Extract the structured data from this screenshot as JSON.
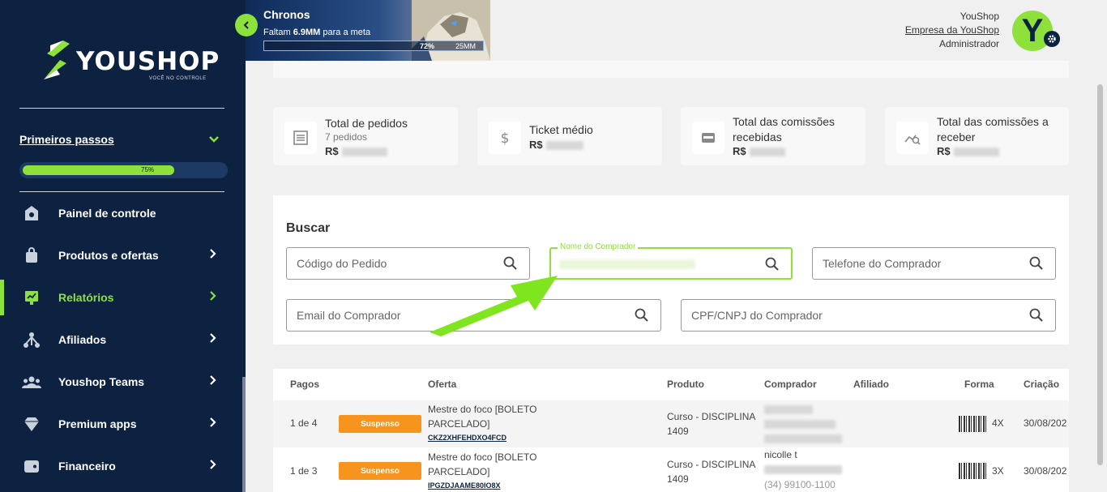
{
  "brand": {
    "name": "YOUSHOP",
    "tagline": "VOCÊ NO CONTROLE"
  },
  "onboarding": {
    "label": "Primeiros passos",
    "progress_text": "75%",
    "progress": 0.75
  },
  "sidebar": {
    "items": [
      {
        "label": "Painel de controle",
        "icon": "dashboard-icon",
        "chevron": false,
        "active": false
      },
      {
        "label": "Produtos e ofertas",
        "icon": "bag-icon",
        "chevron": true,
        "active": false
      },
      {
        "label": "Relatórios",
        "icon": "report-icon",
        "chevron": true,
        "active": true
      },
      {
        "label": "Afiliados",
        "icon": "affiliates-icon",
        "chevron": true,
        "active": false
      },
      {
        "label": "Youshop Teams",
        "icon": "team-icon",
        "chevron": true,
        "active": false
      },
      {
        "label": "Premium apps",
        "icon": "diamond-icon",
        "chevron": true,
        "active": false
      },
      {
        "label": "Financeiro",
        "icon": "wallet-icon",
        "chevron": true,
        "active": false
      }
    ]
  },
  "banner": {
    "title": "Chronos",
    "sub_prefix": "Faltam",
    "sub_amount": "6.9MM",
    "sub_suffix": "para a meta",
    "progress_text": "72%",
    "max_text": "25MM",
    "progress": 0.72
  },
  "user": {
    "name": "YouShop",
    "company": "Empresa da YouShop",
    "role": "Administrador",
    "avatar_letter": "Y"
  },
  "stats": [
    {
      "title": "Total de pedidos",
      "sub": "7 pedidos",
      "value_prefix": "R$",
      "icon": "list-icon"
    },
    {
      "title": "Ticket médio",
      "sub": "",
      "value_prefix": "R$",
      "icon": "dollar-icon"
    },
    {
      "title": "Total das comissões recebidas",
      "sub": "",
      "value_prefix": "R$",
      "icon": "wallet-card-icon"
    },
    {
      "title": "Total das comissões a receber",
      "sub": "",
      "value_prefix": "R$",
      "icon": "chart-search-icon"
    }
  ],
  "search": {
    "title": "Buscar",
    "fields": {
      "order_code": "Código do Pedido",
      "buyer_name": "Nome do Comprador",
      "buyer_phone": "Telefone do Comprador",
      "buyer_email": "Email do Comprador",
      "buyer_doc": "CPF/CNPJ do Comprador"
    }
  },
  "table": {
    "headers": {
      "paid": "Pagos",
      "offer": "Oferta",
      "product": "Produto",
      "buyer": "Comprador",
      "affiliate": "Afiliado",
      "method": "Forma",
      "created": "Criação"
    },
    "rows": [
      {
        "paid": "1 de 4",
        "status": "Suspenso",
        "offer_name": "Mestre do foco [BOLETO PARCELADO]",
        "offer_code": "CKZ2XHFEHDXO4FCD",
        "product": "Curso - DISCIPLINA 1409",
        "buyer": "",
        "installments": "4X",
        "created": "30/08/202"
      },
      {
        "paid": "1 de 3",
        "status": "Suspenso",
        "offer_name": "Mestre do foco [BOLETO PARCELADO]",
        "offer_code": "IPGZDJAAME80IO8X",
        "product": "Curso - DISCIPLINA 1409",
        "buyer": "nicolle t",
        "buyer_phone": "(34) 99100-1100",
        "installments": "3X",
        "created": "30/08/202"
      }
    ]
  },
  "colors": {
    "accent": "#8ee03a",
    "sidebar": "#0d2240",
    "badge": "#f7941d"
  }
}
